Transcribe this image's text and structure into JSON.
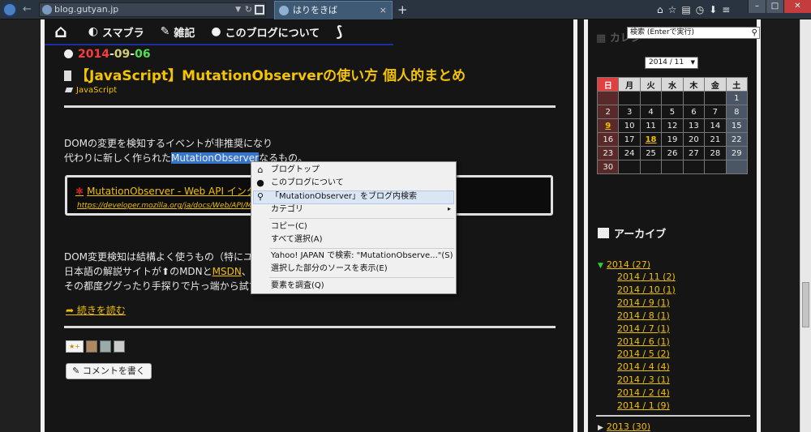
{
  "browser": {
    "url": "blog.gutyan.jp",
    "tab_title": "はりをきば",
    "tab_close": "×",
    "new_tab": "+"
  },
  "nav": {
    "items": [
      "スマブラ",
      "雑記",
      "このブログについて"
    ]
  },
  "post": {
    "date_year": "2014",
    "date_month": "09",
    "date_day": "06",
    "date_sep": "-",
    "title": "【JavaScript】MutationObserverの使い方 個人的まとめ",
    "tag": "JavaScript",
    "para1_line1": "DOMの変更を検知するイベントが非推奨になり",
    "para1_line2_pre": "代わりに新しく作られた",
    "para1_line2_hl": "MutationObserver",
    "para1_line2_post": "なるもの。",
    "link_title": "MutationObserver - Web API インタ",
    "link_url": "https://developer.mozilla.org/ja/docs/Web/API/MutationObserver",
    "para2_line1": "DOM変更検知は結構よく使うもの（特にユー",
    "para2_line2_pre": "日本語の解説サイトが",
    "para2_line2_mid": "のMDNと",
    "para2_line2_link": "MSDN",
    "para2_line2_post": "、",
    "para2_line3": "その都度ググったり手探りで片っ端から試す",
    "read_more": "続きを読む",
    "add_star": "★+",
    "comment_button": "コメントを書く"
  },
  "context_menu": {
    "items": [
      "ブログトップ",
      "このブログについて",
      "「MutationObserver」をブログ内検索",
      "カテゴリ",
      "コピー(C)",
      "すべて選択(A)",
      "Yahoo! JAPAN で検索: \"MutationObserve...\"(S)",
      "選択した部分のソースを表示(E)",
      "要素を調査(Q)"
    ],
    "submenu_arrow": "▸"
  },
  "sidebar": {
    "calendar_heading": "カレン",
    "search_placeholder": "検索 (Enterで実行)",
    "month_select": "2014 / 11",
    "weekdays": [
      "日",
      "月",
      "火",
      "水",
      "木",
      "金",
      "土"
    ],
    "weeks": [
      [
        "",
        "",
        "",
        "",
        "",
        "",
        "1"
      ],
      [
        "2",
        "3",
        "4",
        "5",
        "6",
        "7",
        "8"
      ],
      [
        "9",
        "10",
        "11",
        "12",
        "13",
        "14",
        "15"
      ],
      [
        "16",
        "17",
        "18",
        "19",
        "20",
        "21",
        "22"
      ],
      [
        "23",
        "24",
        "25",
        "26",
        "27",
        "28",
        "29"
      ],
      [
        "30",
        "",
        "",
        "",
        "",
        "",
        ""
      ]
    ],
    "linked_days": [
      "9",
      "18"
    ],
    "archive_heading": "アーカイブ",
    "year_2014": "2014 (27)",
    "months_2014": [
      "2014 / 11 (2)",
      "2014 / 10 (1)",
      "2014 / 9 (1)",
      "2014 / 8 (1)",
      "2014 / 7 (1)",
      "2014 / 6 (1)",
      "2014 / 5 (2)",
      "2014 / 4 (4)",
      "2014 / 3 (1)",
      "2014 / 2 (4)",
      "2014 / 1 (9)"
    ],
    "year_2013": "2013 (30)"
  },
  "colors": {
    "link": "#f0c000",
    "title": "#f5c400",
    "highlight": "#3874c8",
    "nav_underline": "#1a2ea0"
  },
  "icons": [
    "home-icon",
    "smash-icon",
    "pencil-icon",
    "person-icon",
    "rss-icon",
    "clock-icon",
    "bookmark-icon",
    "tag-icon",
    "search-icon",
    "calendar-icon",
    "archive-icon"
  ]
}
